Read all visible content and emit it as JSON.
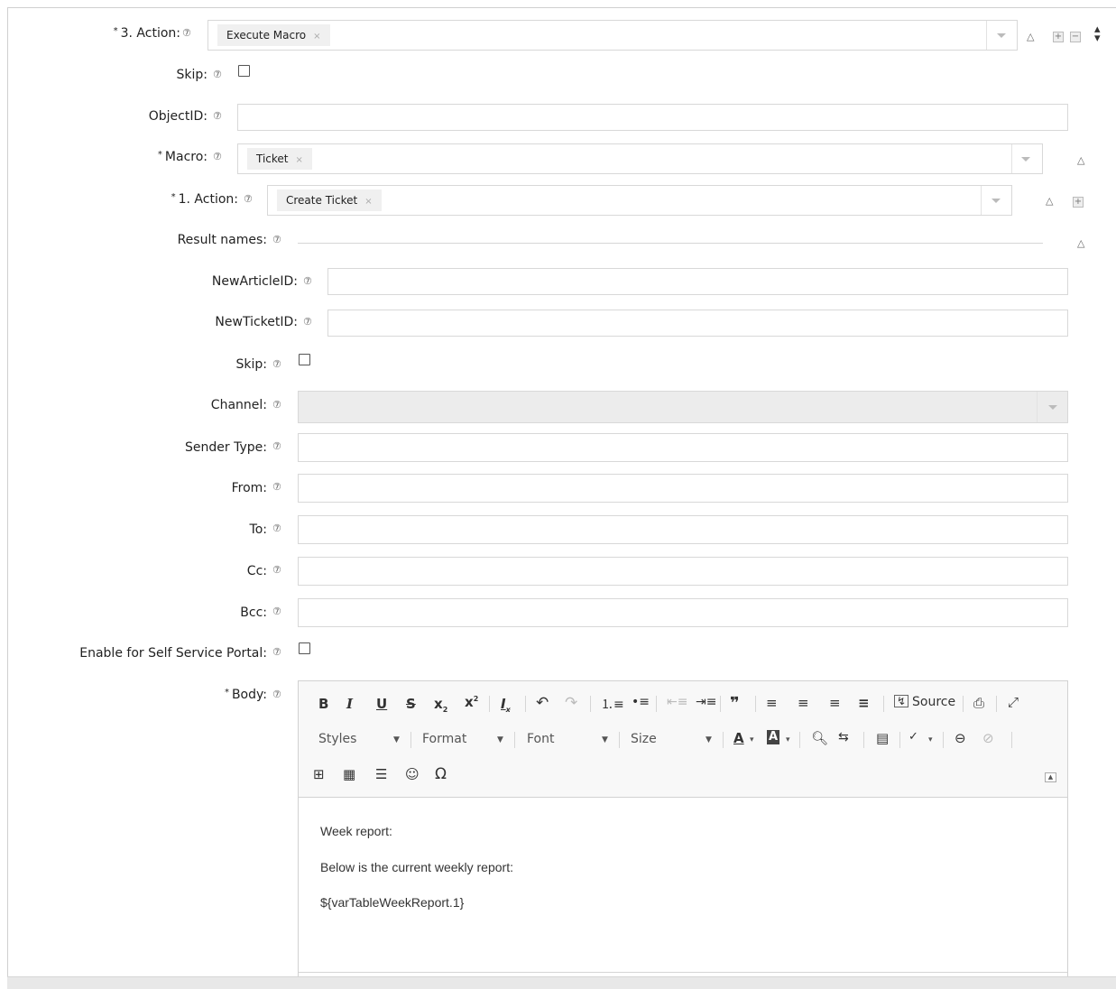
{
  "form": {
    "action3": {
      "label": "3. Action:",
      "value": "Execute Macro"
    },
    "skip1": {
      "label": "Skip:"
    },
    "objectid": {
      "label": "ObjectID:",
      "value": ""
    },
    "macro": {
      "label": "Macro:",
      "value": "Ticket"
    },
    "action1": {
      "label": "1. Action:",
      "value": "Create Ticket"
    },
    "result_names": {
      "label": "Result names:"
    },
    "new_article_id": {
      "label": "NewArticleID:",
      "value": ""
    },
    "new_ticket_id": {
      "label": "NewTicketID:",
      "value": ""
    },
    "skip2": {
      "label": "Skip:"
    },
    "channel": {
      "label": "Channel:",
      "value": ""
    },
    "sender_type": {
      "label": "Sender Type:",
      "value": ""
    },
    "from": {
      "label": "From:",
      "value": ""
    },
    "to": {
      "label": "To:",
      "value": ""
    },
    "cc": {
      "label": "Cc:",
      "value": ""
    },
    "bcc": {
      "label": "Bcc:",
      "value": ""
    },
    "self_service": {
      "label": "Enable for Self Service Portal:"
    },
    "body": {
      "label": "Body:"
    },
    "required_mark": "*",
    "help_glyph": "⑦",
    "remove_glyph": "×"
  },
  "editor": {
    "toolbar": {
      "source_label": "Source",
      "styles_label": "Styles",
      "format_label": "Format",
      "font_label": "Font",
      "size_label": "Size"
    },
    "content": {
      "line1": "Week report:",
      "line2": "Below is the current weekly report:",
      "line3": "${varTableWeekReport.1}"
    }
  }
}
